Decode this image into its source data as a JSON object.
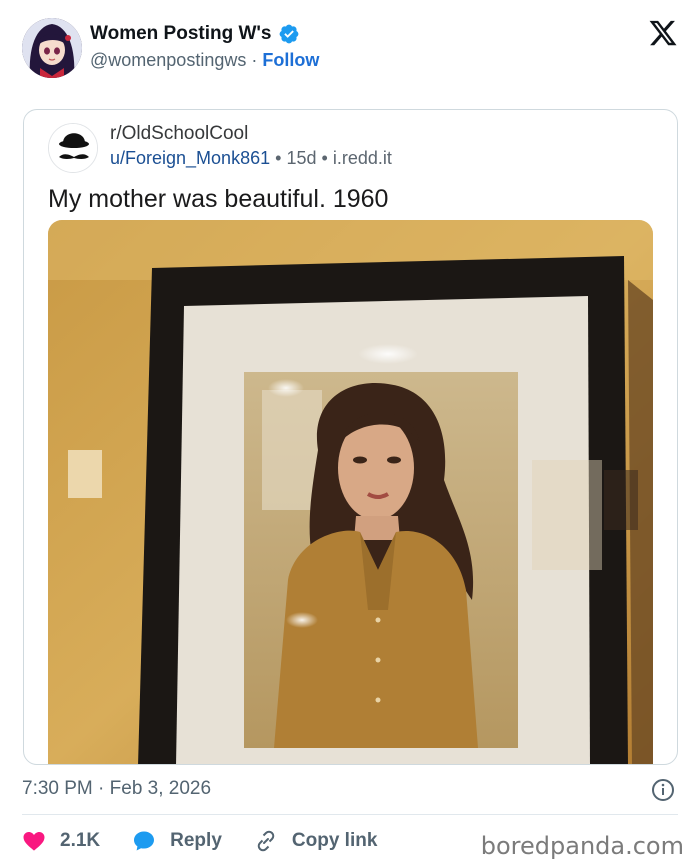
{
  "tweet": {
    "display_name": "Women Posting W's",
    "handle": "@womenpostingws",
    "separator": "·",
    "follow_label": "Follow",
    "timestamp": "7:30 PM · Feb 3, 2026"
  },
  "quoted_post": {
    "subreddit": "r/OldSchoolCool",
    "username": "u/Foreign_Monk861",
    "age": "15d",
    "domain": "i.redd.it",
    "meta_separator": "•",
    "title": "My mother was beautiful. 1960"
  },
  "actions": {
    "like_count": "2.1K",
    "reply_label": "Reply",
    "copy_link_label": "Copy link"
  },
  "watermark": "boredpanda.com",
  "icons": {
    "verified": "verified-badge-icon",
    "x_logo": "x-logo-icon",
    "info": "info-icon",
    "like": "heart-icon",
    "reply": "speech-bubble-icon",
    "copy_link": "link-icon"
  },
  "colors": {
    "follow_blue": "#1d6fd6",
    "verified_blue": "#1d9bf0",
    "like_pink": "#f91880",
    "reddit_user_blue": "#1b4f93",
    "muted_gray": "#536471"
  }
}
